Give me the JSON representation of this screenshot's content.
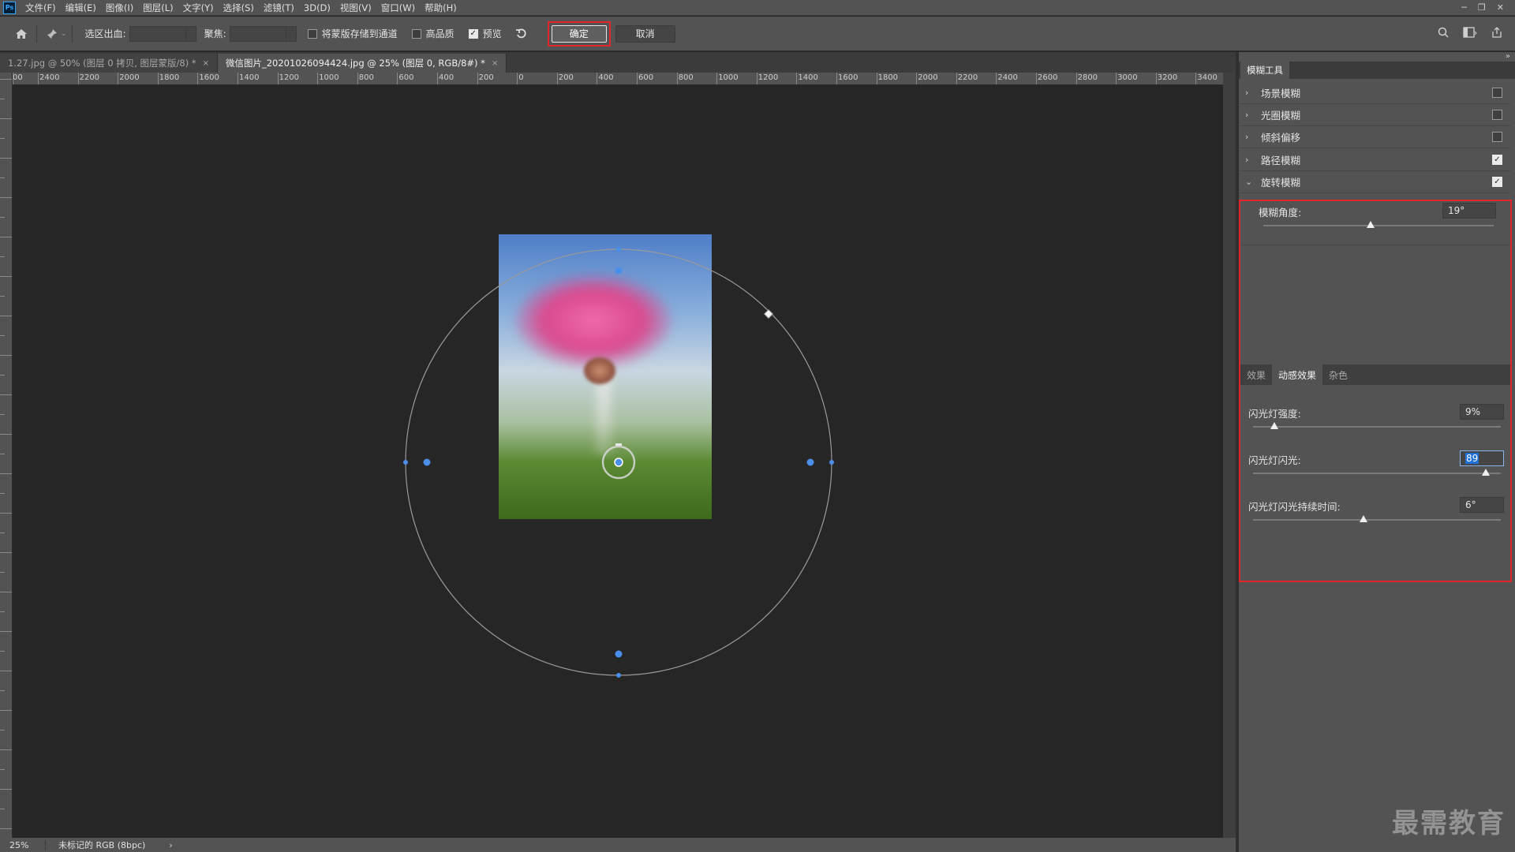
{
  "app": {
    "logo": "Ps"
  },
  "menu": [
    "文件(F)",
    "编辑(E)",
    "图像(I)",
    "图层(L)",
    "文字(Y)",
    "选择(S)",
    "滤镜(T)",
    "3D(D)",
    "视图(V)",
    "窗口(W)",
    "帮助(H)"
  ],
  "window_controls": {
    "minimize": "─",
    "restore": "❐",
    "close": "✕"
  },
  "options": {
    "home_icon": "home-icon",
    "pin_icon": "pin-icon",
    "output_label": "选区出血:",
    "focus_label": "聚焦:",
    "save_mask_label": "将蒙版存储到通道",
    "save_mask_checked": false,
    "high_quality_label": "高品质",
    "high_quality_checked": false,
    "preview_label": "预览",
    "preview_checked": true,
    "reset_icon": "undo-icon",
    "ok_label": "确定",
    "cancel_label": "取消"
  },
  "tabs": [
    {
      "label": "1.27.jpg @ 50% (图层 0 拷贝, 图层蒙版/8) *",
      "active": false,
      "close": "×"
    },
    {
      "label": "微信图片_20201026094424.jpg @ 25% (图层 0, RGB/8#) *",
      "active": true,
      "close": "×"
    }
  ],
  "ruler_top": [
    "00",
    "2400",
    "2200",
    "2000",
    "1800",
    "1600",
    "1400",
    "1200",
    "1000",
    "800",
    "600",
    "400",
    "200",
    "0",
    "200",
    "400",
    "600",
    "800",
    "1000",
    "1200",
    "1400",
    "1600",
    "1800",
    "2000",
    "2200",
    "2400",
    "2600",
    "2800",
    "3000",
    "3200",
    "3400"
  ],
  "status": {
    "zoom": "25%",
    "doc_info": "未标记的 RGB (8bpc)",
    "arrow": "›"
  },
  "panel": {
    "title": "模糊工具",
    "collapse": "»",
    "blur_tools": [
      {
        "label": "场景模糊",
        "checked": false,
        "expanded": false
      },
      {
        "label": "光圈模糊",
        "checked": false,
        "expanded": false
      },
      {
        "label": "倾斜偏移",
        "checked": false,
        "expanded": false
      },
      {
        "label": "路径模糊",
        "checked": true,
        "expanded": false
      },
      {
        "label": "旋转模糊",
        "checked": true,
        "expanded": true
      }
    ],
    "blur_angle": {
      "label": "模糊角度:",
      "value": "19°",
      "fraction": 0.44
    },
    "effect_tabs": [
      {
        "label": "效果",
        "active": false
      },
      {
        "label": "动感效果",
        "active": true
      },
      {
        "label": "杂色",
        "active": false
      }
    ],
    "strobe_strength": {
      "label": "闪光灯强度:",
      "value": "9%",
      "fraction": 0.09
    },
    "strobe_flashes": {
      "label": "闪光灯闪光:",
      "value": "89",
      "fraction": 0.94
    },
    "strobe_duration": {
      "label": "闪光灯闪光持续时间:",
      "value": "6°",
      "fraction": 0.43
    }
  },
  "watermark": "最需教育",
  "colors": {
    "accent_red": "#e0252b",
    "handle_blue": "#4a8fe8",
    "panel_bg": "#535353",
    "canvas_bg": "#262626"
  }
}
